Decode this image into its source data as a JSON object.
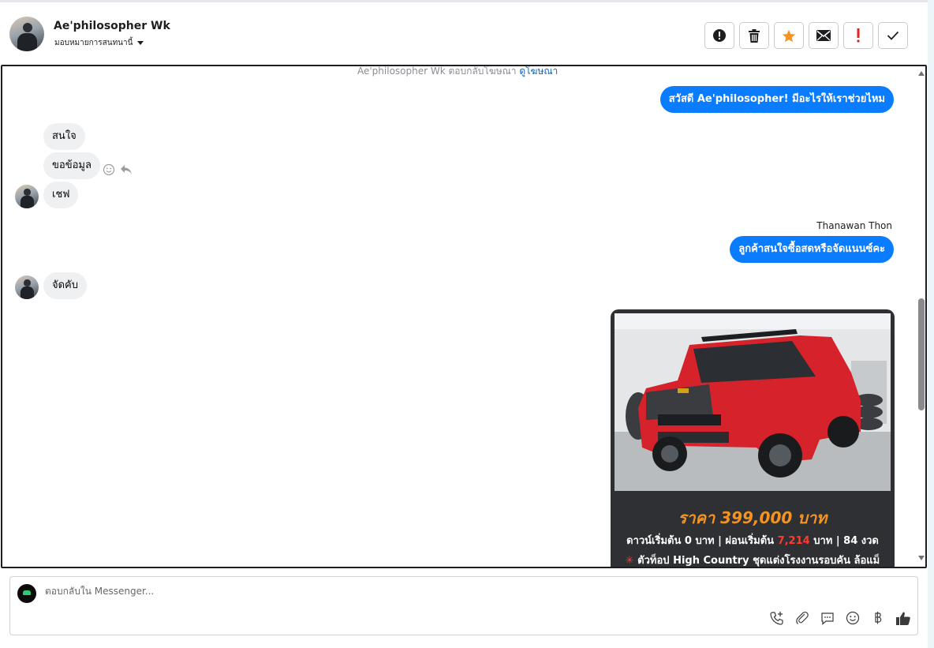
{
  "header": {
    "contact_name": "Ae'philosopher Wk",
    "assign_label": "มอบหมายการสนทนานี้"
  },
  "toolbar": [
    "alert-icon",
    "trash-icon",
    "star-icon",
    "mail-icon",
    "exclamation-icon",
    "check-icon"
  ],
  "colors": {
    "outgoing": "#0a7cff",
    "incoming": "#eef0f2",
    "star": "#f59322",
    "alert": "#e02424"
  },
  "conversation": {
    "system_note": "Ae'philosopher Wk ตอบกลับโฆษณา",
    "system_link": "ดูโฆษณา",
    "greeting": "สวัสดี Ae'philosopher! มีอะไรให้เราช่วยไหม",
    "incoming_1": "สนใจ",
    "incoming_2": "ขอข้อมูล",
    "incoming_3": "เชฟ",
    "agent_name": "Thanawan Thon",
    "agent_reply": "ลูกค้าสนใจซื้อสดหรือจัดแนนซ์คะ",
    "incoming_4": "จัดคับ"
  },
  "ad_card": {
    "price": "ราคา 399,000 บาท",
    "line2_a": "ดาวน์เริ่มต้น 0 บาท | ผ่อนเริ่มต้น",
    "line2_num": "7,214",
    "line2_b": "บาท | 84 งวด",
    "line3_star": "✳",
    "line3": "ตัวท็อป High Country ชุดแต่งโรงงานรอบคัน ล้อแม็"
  },
  "composer": {
    "placeholder": "ตอบกลับใน Messenger...",
    "tools": [
      "phone-add-icon",
      "attach-icon",
      "quick-reply-icon",
      "emoji-icon",
      "baht-icon",
      "like-icon"
    ]
  }
}
